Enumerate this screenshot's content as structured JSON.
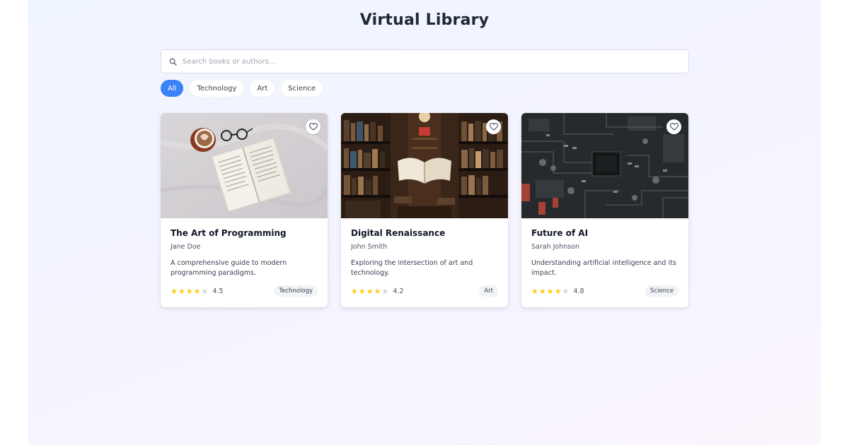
{
  "page_title": "Virtual Library",
  "search": {
    "placeholder": "Search books or authors...",
    "value": ""
  },
  "filters": [
    {
      "label": "All",
      "active": true
    },
    {
      "label": "Technology",
      "active": false
    },
    {
      "label": "Art",
      "active": false
    },
    {
      "label": "Science",
      "active": false
    }
  ],
  "colors": {
    "accent": "#3b82f6",
    "star_filled": "#facc15",
    "star_empty": "#d1d5db"
  },
  "books": [
    {
      "title": "The Art of Programming",
      "author": "Jane Doe",
      "description": "A comprehensive guide to modern programming paradigms.",
      "rating": 4.5,
      "rating_label": "4.5",
      "stars_filled": 4,
      "category": "Technology",
      "image": "open-book-with-coffee-and-glasses"
    },
    {
      "title": "Digital Renaissance",
      "author": "John Smith",
      "description": "Exploring the intersection of art and technology.",
      "rating": 4.2,
      "rating_label": "4.2",
      "stars_filled": 4,
      "category": "Art",
      "image": "book-floating-in-library-aisle"
    },
    {
      "title": "Future of AI",
      "author": "Sarah Johnson",
      "description": "Understanding artificial intelligence and its impact.",
      "rating": 4.8,
      "rating_label": "4.8",
      "stars_filled": 4,
      "category": "Science",
      "image": "circuit-board-closeup"
    }
  ]
}
